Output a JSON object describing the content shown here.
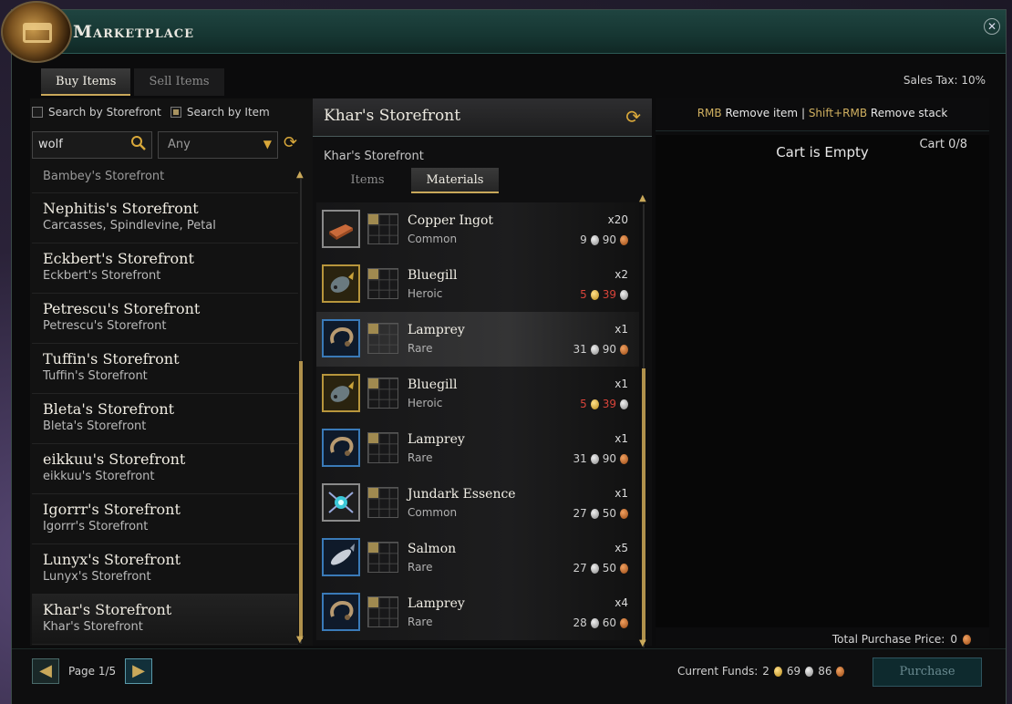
{
  "window": {
    "title": "Marketplace",
    "close_label": "✕"
  },
  "tabs": {
    "buy": "Buy Items",
    "sell": "Sell Items"
  },
  "sales_tax": "Sales Tax:  10%",
  "search": {
    "by_storefront_label": "Search by Storefront",
    "by_item_label": "Search by Item",
    "query_value": "wolf",
    "filter_value": "Any"
  },
  "storefronts": [
    {
      "name": "",
      "desc": "Bambey's Storefront"
    },
    {
      "name": "Nephitis's Storefront",
      "desc": "Carcasses, Spindlevine, Petal"
    },
    {
      "name": "Eckbert's Storefront",
      "desc": "Eckbert's Storefront"
    },
    {
      "name": "Petrescu's Storefront",
      "desc": "Petrescu's Storefront"
    },
    {
      "name": "Tuffin's Storefront",
      "desc": "Tuffin's Storefront"
    },
    {
      "name": "Bleta's Storefront",
      "desc": "Bleta's Storefront"
    },
    {
      "name": "eikkuu's Storefront",
      "desc": "eikkuu's Storefront"
    },
    {
      "name": "Igorrr's Storefront",
      "desc": "Igorrr's Storefront"
    },
    {
      "name": "Lunyx's Storefront",
      "desc": "Lunyx's Storefront"
    },
    {
      "name": "Khar's Storefront",
      "desc": "Khar's Storefront"
    }
  ],
  "storefront": {
    "header": "Khar's Storefront",
    "subtitle": "Khar's Storefront",
    "tabs": [
      "Items",
      "Materials"
    ]
  },
  "items": [
    {
      "name": "Copper Ingot",
      "rarity": "Common",
      "qty": "x20",
      "price": [
        "9",
        "90"
      ],
      "coins": [
        "silver",
        "copper"
      ],
      "red": false,
      "tier": "common",
      "icon": "copper-ingot-icon"
    },
    {
      "name": "Bluegill",
      "rarity": "Heroic",
      "qty": "x2",
      "price": [
        "5",
        "39"
      ],
      "coins": [
        "gold",
        "silver"
      ],
      "red": true,
      "tier": "heroic",
      "icon": "bluegill-fish-icon"
    },
    {
      "name": "Lamprey",
      "rarity": "Rare",
      "qty": "x1",
      "price": [
        "31",
        "90"
      ],
      "coins": [
        "silver",
        "copper"
      ],
      "red": false,
      "tier": "rare",
      "icon": "lamprey-icon"
    },
    {
      "name": "Bluegill",
      "rarity": "Heroic",
      "qty": "x1",
      "price": [
        "5",
        "39"
      ],
      "coins": [
        "gold",
        "silver"
      ],
      "red": true,
      "tier": "heroic",
      "icon": "bluegill-fish-icon"
    },
    {
      "name": "Lamprey",
      "rarity": "Rare",
      "qty": "x1",
      "price": [
        "31",
        "90"
      ],
      "coins": [
        "silver",
        "copper"
      ],
      "red": false,
      "tier": "rare",
      "icon": "lamprey-icon"
    },
    {
      "name": "Jundark Essence",
      "rarity": "Common",
      "qty": "x1",
      "price": [
        "27",
        "50"
      ],
      "coins": [
        "silver",
        "copper"
      ],
      "red": false,
      "tier": "common",
      "icon": "jundark-essence-icon"
    },
    {
      "name": "Salmon",
      "rarity": "Rare",
      "qty": "x5",
      "price": [
        "27",
        "50"
      ],
      "coins": [
        "silver",
        "copper"
      ],
      "red": false,
      "tier": "rare",
      "icon": "salmon-icon"
    },
    {
      "name": "Lamprey",
      "rarity": "Rare",
      "qty": "x4",
      "price": [
        "28",
        "60"
      ],
      "coins": [
        "silver",
        "copper"
      ],
      "red": false,
      "tier": "rare",
      "icon": "lamprey-icon"
    }
  ],
  "cart": {
    "hint_rmb_key": "RMB",
    "hint_rmb": "Remove item",
    "hint_sep": "|",
    "hint_shift_key": "Shift+RMB",
    "hint_shift": "Remove stack",
    "empty_text": "Cart is Empty",
    "count": "Cart  0/8",
    "total_label": "Total Purchase Price:",
    "total_value": "0"
  },
  "footer": {
    "page_label": "Page 1/5",
    "funds_label": "Current Funds:",
    "funds": [
      "2",
      "69",
      "86"
    ],
    "purchase_label": "Purchase"
  },
  "colors": {
    "accent_gold": "#c9a85a",
    "header_teal": "#1f4440",
    "price_red": "#d9443a"
  }
}
